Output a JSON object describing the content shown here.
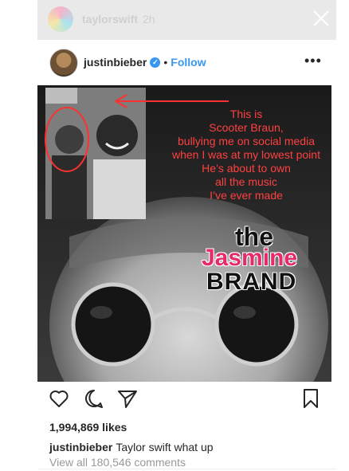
{
  "story": {
    "username": "taylorswift",
    "time": "2h"
  },
  "post": {
    "username": "justinbieber",
    "separator": "•",
    "follow_label": "Follow",
    "more_label": "•••"
  },
  "image": {
    "overlay_lines": [
      "This is",
      "Scooter Braun,",
      "bullying me on social media",
      "when I was at my lowest point",
      "He’s about to own",
      "all the music",
      "I’ve ever made"
    ],
    "watermark": {
      "the": "the",
      "name": "Jasmine",
      "brand": "BRAND"
    },
    "overlay_color": "#ff4040",
    "watermark_accent": "#e72a6a"
  },
  "footer": {
    "likes": "1,994,869 likes",
    "caption_user": "justinbieber",
    "caption_text": "Taylor swift what up",
    "view_all": "View all 180,546 comments"
  },
  "colors": {
    "accent": "#3897f0",
    "text": "#262626",
    "muted": "#999999"
  }
}
